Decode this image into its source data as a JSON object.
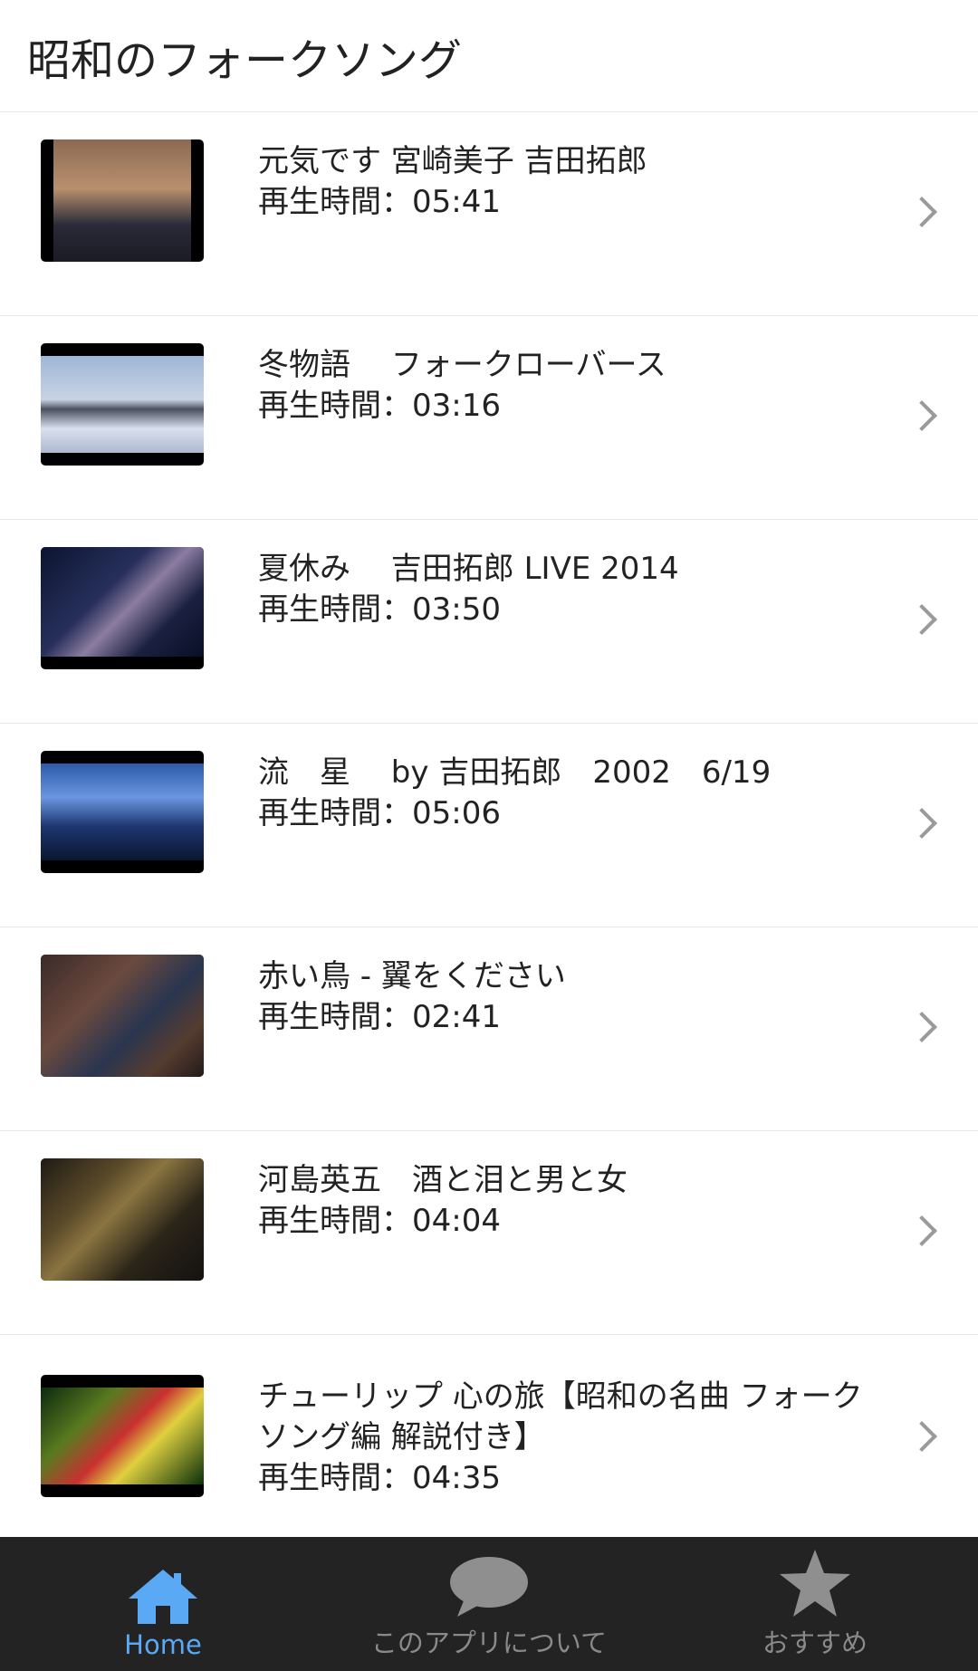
{
  "header": {
    "title": "昭和のフォークソング"
  },
  "videos": [
    {
      "title": "元気です 宮崎美子 吉田拓郎",
      "duration": "再生時間：05:41"
    },
    {
      "title": "冬物語　 フォークローバース",
      "duration": "再生時間：03:16"
    },
    {
      "title": "夏休み　 吉田拓郎 LIVE 2014",
      "duration": "再生時間：03:50"
    },
    {
      "title": "流　星　 by 吉田拓郎　2002　6/19",
      "duration": "再生時間：05:06"
    },
    {
      "title": "赤い鳥 - 翼をください",
      "duration": "再生時間：02:41"
    },
    {
      "title": "河島英五　酒と泪と男と女",
      "duration": "再生時間：04:04"
    },
    {
      "title": "チューリップ 心の旅【昭和の名曲 フォークソング編 解説付き】",
      "duration": "再生時間：04:35"
    }
  ],
  "tabs": [
    {
      "label": "Home",
      "icon": "home-icon",
      "active": true
    },
    {
      "label": "このアプリについて",
      "icon": "chat-bubble-icon",
      "active": false
    },
    {
      "label": "おすすめ",
      "icon": "star-icon",
      "active": false
    }
  ],
  "colors": {
    "accent": "#5aa9f5",
    "tabbar_bg": "#232323",
    "inactive": "#8a8a8a"
  }
}
